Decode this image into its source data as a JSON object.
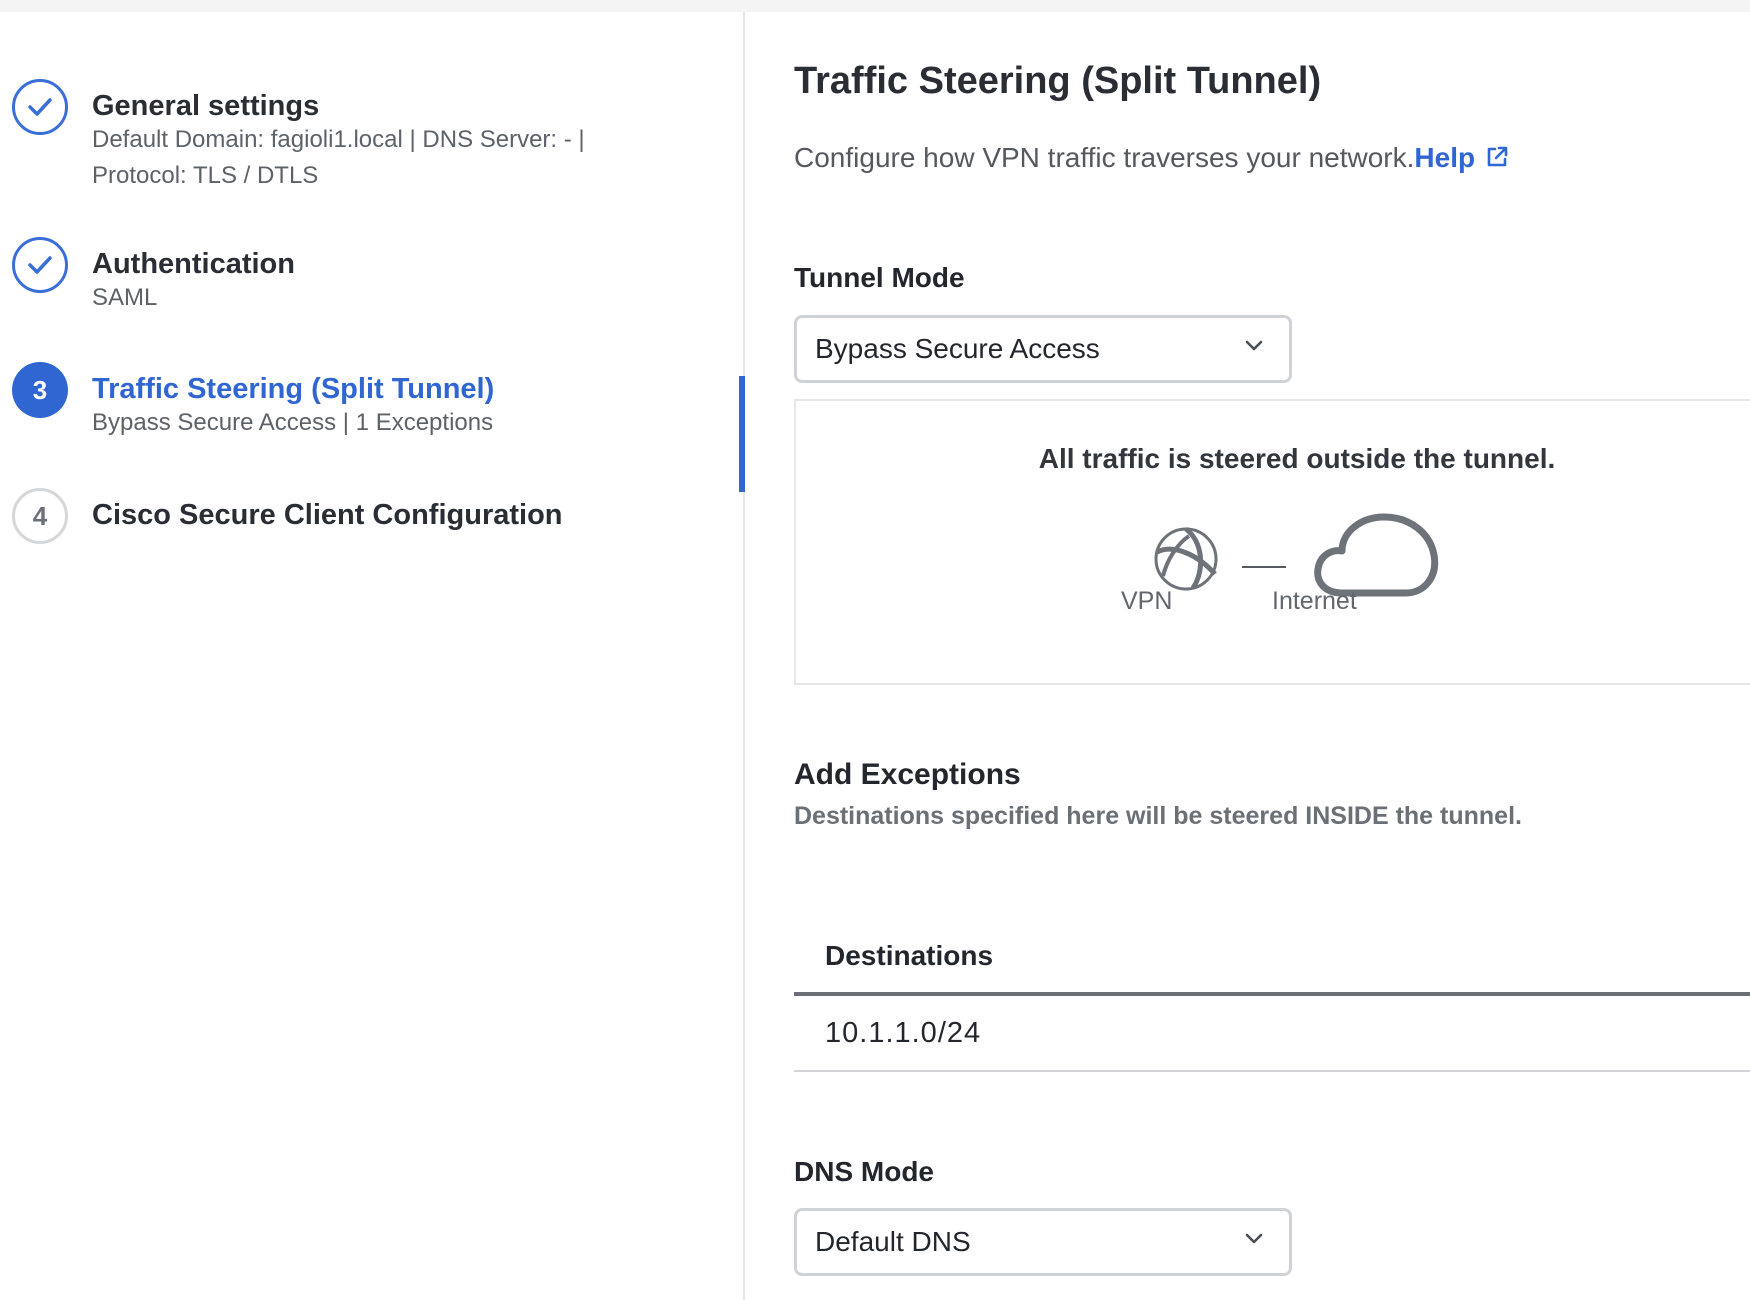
{
  "stepper": {
    "steps": [
      {
        "number": "1",
        "title": "General settings",
        "subtitle": "Default Domain: fagioli1.local | DNS Server: - | Protocol: TLS / DTLS",
        "state": "complete"
      },
      {
        "number": "2",
        "title": "Authentication",
        "subtitle": "SAML",
        "state": "complete"
      },
      {
        "number": "3",
        "title": "Traffic Steering (Split Tunnel)",
        "subtitle": "Bypass Secure Access | 1 Exceptions",
        "state": "active"
      },
      {
        "number": "4",
        "title": "Cisco Secure Client Configuration",
        "subtitle": "",
        "state": "pending"
      }
    ]
  },
  "main": {
    "title": "Traffic Steering (Split Tunnel)",
    "description": "Configure how VPN traffic traverses your network.",
    "help_label": "Help",
    "tunnel_mode": {
      "label": "Tunnel Mode",
      "value": "Bypass Secure Access",
      "diagram": {
        "caption": "All traffic is steered outside the tunnel.",
        "left_label": "VPN",
        "right_label": "Internet"
      }
    },
    "exceptions": {
      "title": "Add Exceptions",
      "subtitle": "Destinations specified here will be steered INSIDE the tunnel.",
      "table": {
        "header": "Destinations",
        "rows": [
          "10.1.1.0/24"
        ]
      }
    },
    "dns_mode": {
      "label": "DNS Mode",
      "value": "Default DNS"
    }
  },
  "colors": {
    "accent": "#2f66d1",
    "text": "#23272d",
    "muted": "#5d6269",
    "border": "#cfd2d6"
  },
  "icons": [
    "check-icon",
    "external-link-icon",
    "chevron-down-icon",
    "vpn-globe-icon",
    "cloud-icon"
  ]
}
